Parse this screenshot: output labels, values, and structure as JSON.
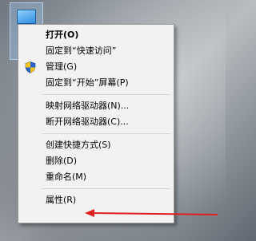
{
  "menu": {
    "items": [
      {
        "label": "打开(O)"
      },
      {
        "label": "固定到“快速访问”"
      },
      {
        "label": "管理(G)",
        "icon": "uac-shield-icon"
      },
      {
        "label": "固定到“开始”屏幕(P)"
      },
      {
        "label": "映射网络驱动器(N)..."
      },
      {
        "label": "断开网络驱动器(C)..."
      },
      {
        "label": "创建快捷方式(S)"
      },
      {
        "label": "删除(D)"
      },
      {
        "label": "重命名(M)"
      },
      {
        "label": "属性(R)"
      }
    ]
  },
  "colors": {
    "arrow": "#e02020",
    "menu_bg": "#f2f2f2"
  }
}
